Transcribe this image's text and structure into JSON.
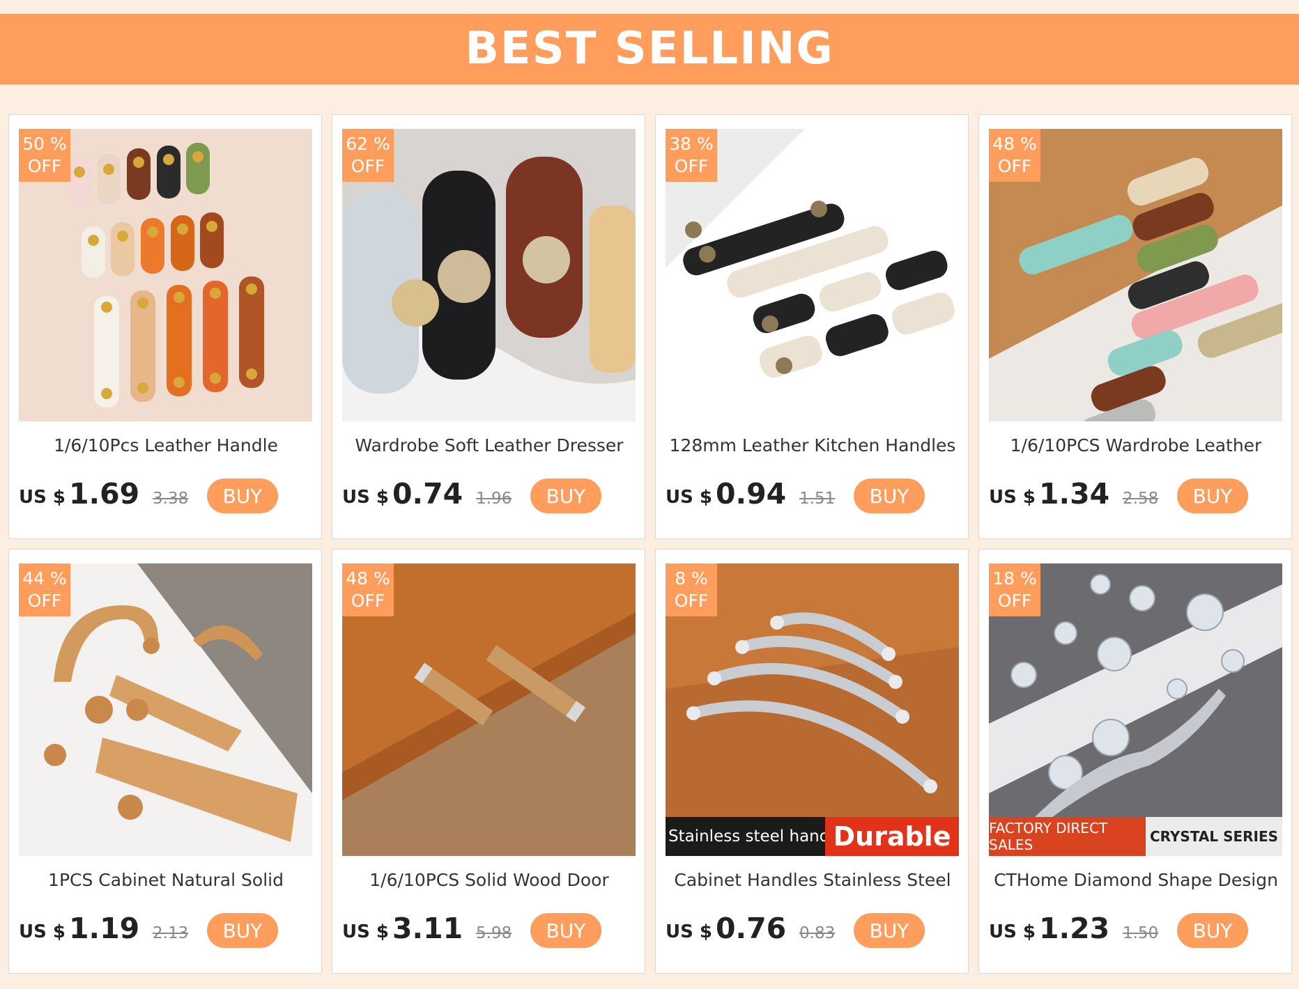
{
  "banner": {
    "title": "BEST SELLING"
  },
  "colors": {
    "accent": "#ff9d5c",
    "background": "#fdeee2"
  },
  "products": [
    {
      "discount": "50 %",
      "off": "OFF",
      "title": "1/6/10Pcs Leather Handle",
      "currency": "US $",
      "price": "1.69",
      "old_price": "3.38",
      "buy": "BUY"
    },
    {
      "discount": "62 %",
      "off": "OFF",
      "title": "Wardrobe Soft Leather Dresser",
      "currency": "US $",
      "price": "0.74",
      "old_price": "1.96",
      "buy": "BUY"
    },
    {
      "discount": "38 %",
      "off": "OFF",
      "title": "128mm Leather Kitchen Handles",
      "currency": "US $",
      "price": "0.94",
      "old_price": "1.51",
      "buy": "BUY"
    },
    {
      "discount": "48 %",
      "off": "OFF",
      "title": "1/6/10PCS Wardrobe Leather",
      "currency": "US $",
      "price": "1.34",
      "old_price": "2.58",
      "buy": "BUY"
    },
    {
      "discount": "44 %",
      "off": "OFF",
      "title": "1PCS Cabinet Natural Solid",
      "currency": "US $",
      "price": "1.19",
      "old_price": "2.13",
      "buy": "BUY"
    },
    {
      "discount": "48 %",
      "off": "OFF",
      "title": "1/6/10PCS Solid Wood Door",
      "currency": "US $",
      "price": "3.11",
      "old_price": "5.98",
      "buy": "BUY"
    },
    {
      "discount": "8  %",
      "off": "OFF",
      "title": "Cabinet Handles Stainless Steel",
      "currency": "US $",
      "price": "0.76",
      "old_price": "0.83",
      "buy": "BUY",
      "overlay": {
        "left": "Stainless steel handle",
        "right": "Durable"
      }
    },
    {
      "discount": "18 %",
      "off": "OFF",
      "title": "CTHome Diamond Shape Design",
      "currency": "US $",
      "price": "1.23",
      "old_price": "1.50",
      "buy": "BUY",
      "overlay": {
        "left": "FACTORY DIRECT SALES",
        "right": "CRYSTAL SERIES"
      }
    }
  ]
}
